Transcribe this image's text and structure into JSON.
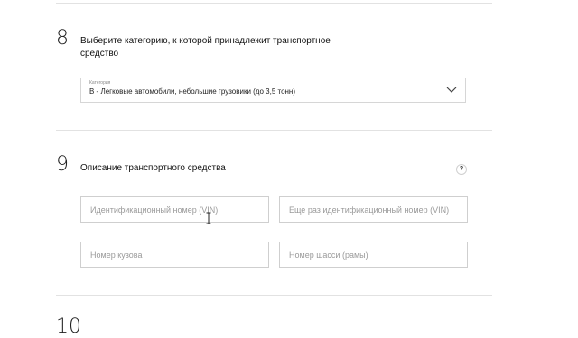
{
  "step8": {
    "number": "8",
    "title": "Выберите категорию, к которой принадлежит транспортное средство",
    "select": {
      "label": "Категория",
      "value": "B - Легковые автомобили, небольшие грузовики (до 3,5 тонн)"
    }
  },
  "step9": {
    "number": "9",
    "title": "Описание транспортного средства",
    "help": "?",
    "fields": {
      "vin": "Идентификационный номер (VIN)",
      "vin_repeat": "Еще раз идентификационный номер (VIN)",
      "body": "Номер кузова",
      "chassis": "Номер шасси (рамы)"
    }
  },
  "step10": {
    "number": "10"
  },
  "icons": {
    "select_arrow": "chevron-down-icon",
    "cursor": "text-cursor-icon",
    "help": "help-icon"
  }
}
